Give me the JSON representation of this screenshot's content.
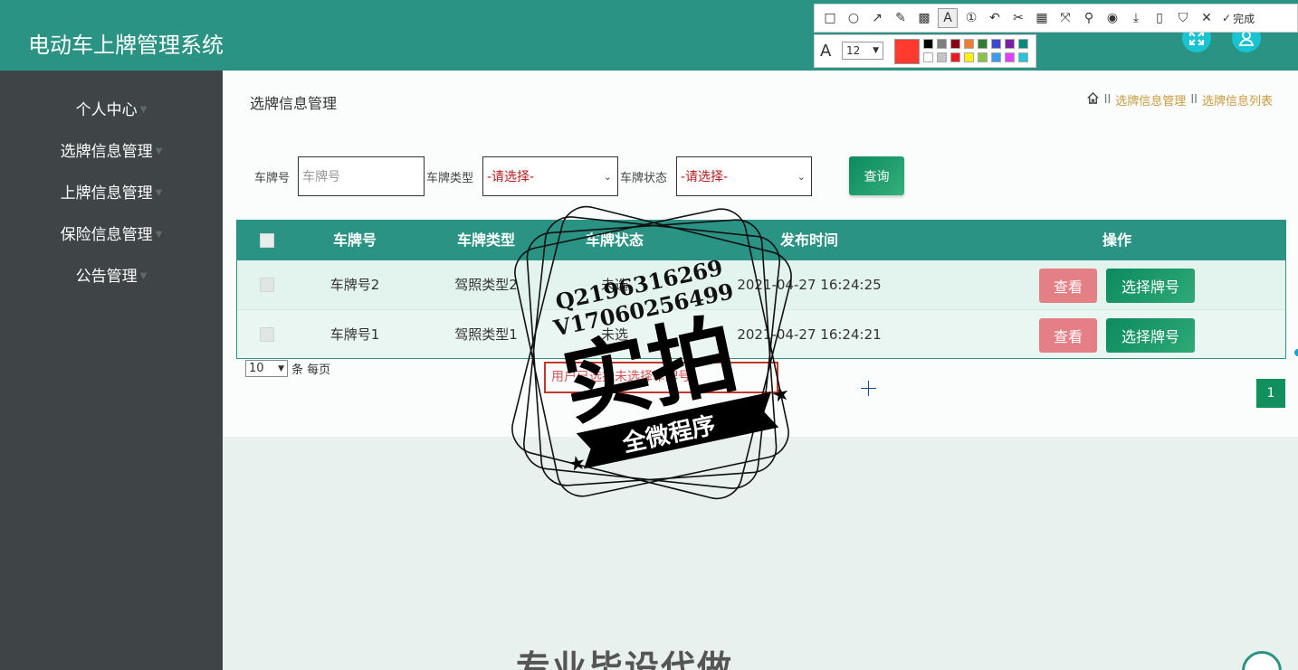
{
  "app": {
    "title": "电动车上牌管理系统"
  },
  "sidebar": {
    "items": [
      {
        "label": "个人中心"
      },
      {
        "label": "选牌信息管理"
      },
      {
        "label": "上牌信息管理"
      },
      {
        "label": "保险信息管理"
      },
      {
        "label": "公告管理"
      }
    ]
  },
  "page": {
    "title": "选牌信息管理",
    "breadcrumb": [
      "选牌信息管理",
      "选牌信息列表"
    ],
    "breadcrumb_sep": "II"
  },
  "filters": {
    "plate_label": "车牌号",
    "plate_placeholder": "车牌号",
    "type_label": "车牌类型",
    "type_selected": "-请选择-",
    "status_label": "车牌状态",
    "status_selected": "-请选择-",
    "query_label": "查询"
  },
  "table": {
    "headers": [
      "车牌号",
      "车牌类型",
      "车牌状态",
      "发布时间",
      "操作"
    ],
    "rows": [
      {
        "plate": "车牌号2",
        "type": "驾照类型2",
        "status": "未选",
        "time": "2021-04-27 16:24:25"
      },
      {
        "plate": "车牌号1",
        "type": "驾照类型1",
        "status": "未选",
        "time": "2021-04-27 16:24:21"
      }
    ],
    "view_label": "查看",
    "choose_label": "选择牌号"
  },
  "pagination": {
    "page_size": "10",
    "per_page_text": "条 每页",
    "current_page": "1"
  },
  "notice": {
    "text": "用户已选择未选择车牌号"
  },
  "screenshot_tool": {
    "done_label": "完成",
    "font_size": "12",
    "current_color": "#ff3b30"
  },
  "watermark": {
    "line1": "Q2196316269",
    "line2": "V17060256499",
    "big": "实拍",
    "ribbon": "全微程序"
  },
  "footer": {
    "big_text": "专业毕设代做"
  },
  "icons": [
    "home-icon",
    "fullscreen-icon",
    "user-icon",
    "caret-down-icon",
    "scroll-top-icon"
  ]
}
